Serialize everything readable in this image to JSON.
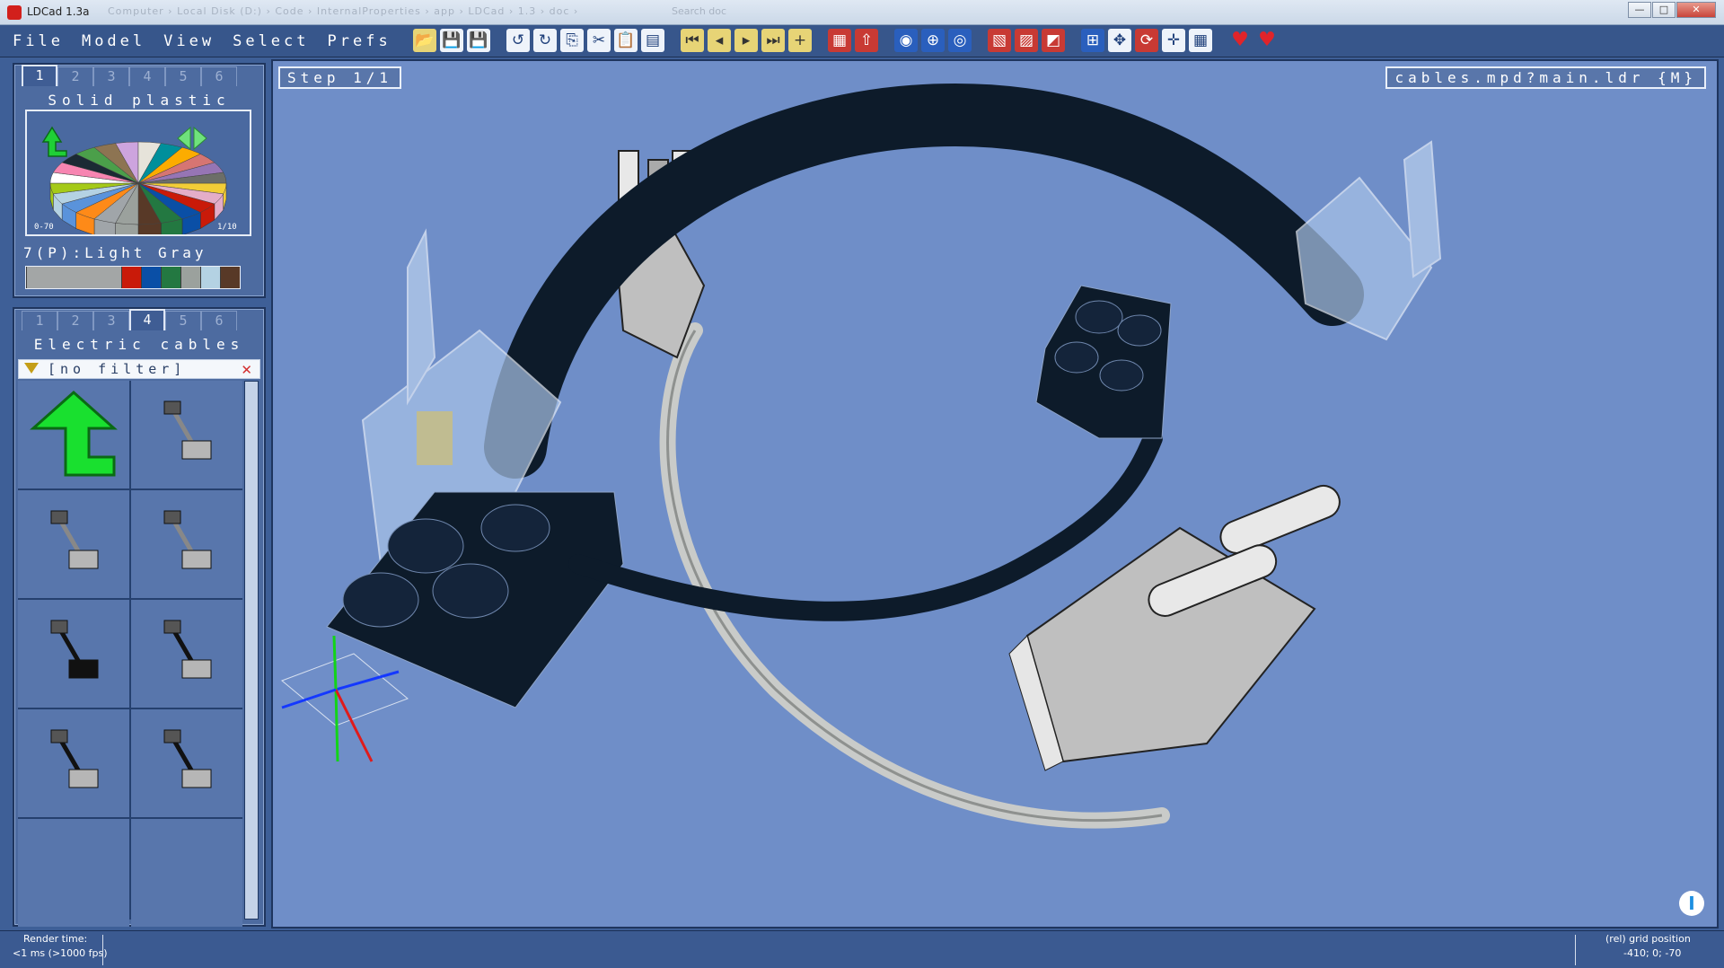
{
  "window": {
    "title": "LDCad 1.3a",
    "ghost_path": "Computer  ›  Local Disk (D:)  ›  Code  ›  InternalProperties  ›  app  ›  LDCad  ›  1.3  ›  doc  ›",
    "ghost_search": "Search doc",
    "controls": [
      "—",
      "□",
      "✕"
    ]
  },
  "menu": [
    "File",
    "Model",
    "View",
    "Select",
    "Prefs"
  ],
  "toolbar": [
    {
      "icon": "open-folder-icon",
      "glyph": "📂",
      "style": "y"
    },
    {
      "icon": "save-icon",
      "glyph": "💾",
      "style": "w"
    },
    {
      "icon": "save-all-icon",
      "glyph": "💾",
      "style": "w"
    },
    {
      "icon": "undo-icon",
      "glyph": "↺",
      "style": "w"
    },
    {
      "icon": "redo-icon",
      "glyph": "↻",
      "style": "w"
    },
    {
      "icon": "copy-icon",
      "glyph": "⎘",
      "style": "w"
    },
    {
      "icon": "cut-icon",
      "glyph": "✂",
      "style": "w"
    },
    {
      "icon": "paste-icon",
      "glyph": "📋",
      "style": "w"
    },
    {
      "icon": "clipboard-icon",
      "glyph": "▤",
      "style": "w"
    },
    {
      "icon": "first-step-icon",
      "glyph": "⏮",
      "style": "y"
    },
    {
      "icon": "prev-step-icon",
      "glyph": "◂",
      "style": "y"
    },
    {
      "icon": "next-step-icon",
      "glyph": "▸",
      "style": "y"
    },
    {
      "icon": "last-step-icon",
      "glyph": "⏭",
      "style": "y"
    },
    {
      "icon": "add-step-icon",
      "glyph": "+",
      "style": "y"
    },
    {
      "icon": "stack-icon",
      "glyph": "▦",
      "style": "r"
    },
    {
      "icon": "stack-up-icon",
      "glyph": "⇧",
      "style": "r"
    },
    {
      "icon": "color-pick-icon",
      "glyph": "◉",
      "style": "b"
    },
    {
      "icon": "rotate-center-icon",
      "glyph": "⊕",
      "style": "b"
    },
    {
      "icon": "grid-snap-icon",
      "glyph": "◎",
      "style": "b"
    },
    {
      "icon": "hide-icon",
      "glyph": "▧",
      "style": "r"
    },
    {
      "icon": "ghost-icon",
      "glyph": "▨",
      "style": "r"
    },
    {
      "icon": "cut-away-icon",
      "glyph": "◩",
      "style": "r"
    },
    {
      "icon": "relative-grid-icon",
      "glyph": "⊞",
      "style": "b"
    },
    {
      "icon": "move-icon",
      "glyph": "✥",
      "style": "w"
    },
    {
      "icon": "rotate-icon",
      "glyph": "⟳",
      "style": "r"
    },
    {
      "icon": "pan-icon",
      "glyph": "✛",
      "style": "w"
    },
    {
      "icon": "grid-icon",
      "glyph": "▦",
      "style": "w"
    },
    {
      "icon": "favorite-icon",
      "glyph": "♥",
      "style": "h"
    },
    {
      "icon": "favorite-list-icon",
      "glyph": "♥",
      "style": "h"
    }
  ],
  "color_panel": {
    "tabs": [
      "1",
      "2",
      "3",
      "4",
      "5",
      "6"
    ],
    "active_tab": 0,
    "title": "Solid plastic",
    "range_label": "0-70",
    "page_label": "1/10",
    "selected_color": "7(P):Light Gray",
    "recent_colors": [
      "#a3a6a6",
      "#c91a09",
      "#0a4fa6",
      "#237841",
      "#9ba19d",
      "#b4d2e3",
      "#583927"
    ]
  },
  "parts_panel": {
    "tabs": [
      "1",
      "2",
      "3",
      "4",
      "5",
      "6"
    ],
    "active_tab": 3,
    "title": "Electric cables",
    "filter": "[no filter]",
    "items": [
      "up-level-arrow",
      "cable-gray-long",
      "cable-gray-bend",
      "cable-gray-angled",
      "cable-black-brick",
      "cable-black-short",
      "cable-black-plug",
      "cable-black-cap",
      "empty",
      "empty"
    ]
  },
  "viewport": {
    "step": "Step 1/1",
    "model": "cables.mpd?main.ldr {M}",
    "background": "#6f8ec8"
  },
  "status": {
    "render_label": "Render time:",
    "render_value": "<1 ms (>1000 fps)",
    "grid_label": "(rel) grid position",
    "grid_value": "-410; 0; -70"
  }
}
